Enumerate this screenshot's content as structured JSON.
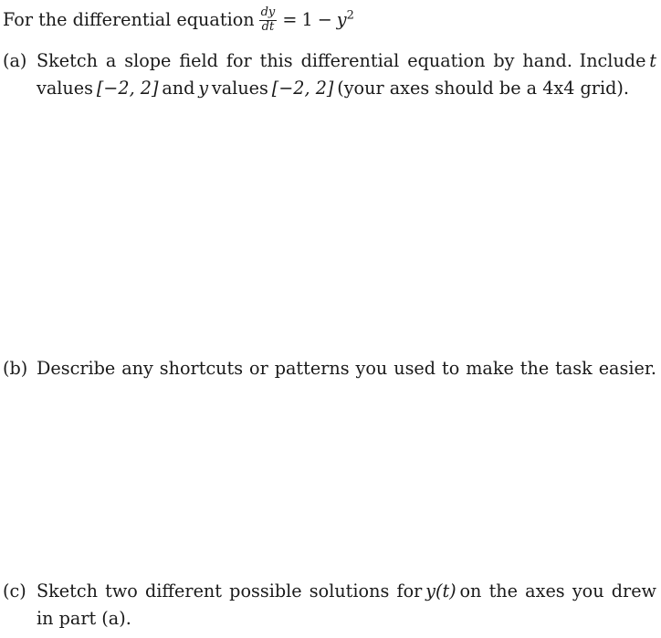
{
  "document": {
    "type": "math-worksheet",
    "background_color": "#ffffff",
    "text_color": "#1a1a1a",
    "intro": {
      "lead_text": "For the differential equation",
      "equation": {
        "derivative_numerator": "dy",
        "derivative_denominator": "dt",
        "equals": "=",
        "rhs_first_term": "1",
        "minus": "−",
        "rhs_variable": "y",
        "rhs_exponent": "2",
        "plain": "dy/dt = 1 − y²"
      }
    },
    "items": [
      {
        "label": "(a)",
        "lines": [
          "Sketch a slope field for this differential equation by hand.",
          "Include",
          "t",
          "values",
          "[−2, 2]",
          "and",
          "y",
          "values",
          "[−2, 2]",
          "(your axes should be a 4x4 grid)."
        ],
        "line1_part1": "Sketch a slope field for this differential equation by hand.",
        "line1_part2": "Include",
        "line1_math": "t",
        "line2_part1": "values",
        "line2_math1": "[−2, 2]",
        "line2_part2": "and",
        "line2_math2": "y",
        "line2_part3": "values",
        "line2_math3": "[−2, 2]",
        "line2_part4": "(your axes should be a 4x4 grid).",
        "has_answer_space": true
      },
      {
        "label": "(b)",
        "line1": "Describe any shortcuts or patterns you used to make the task easier.",
        "has_answer_space": true
      },
      {
        "label": "(c)",
        "line1_part1": "Sketch two different possible solutions for",
        "line1_math": "y(t)",
        "line1_part2": "on the axes you drew",
        "line2": "in part (a).",
        "has_answer_space": false
      }
    ],
    "answer_spaces": [
      {
        "name": "answer-space-a",
        "after_item": "(a)",
        "purpose": "blank region for hand-drawn slope field"
      },
      {
        "name": "answer-space-b",
        "after_item": "(b)",
        "purpose": "blank region for written response"
      }
    ]
  }
}
